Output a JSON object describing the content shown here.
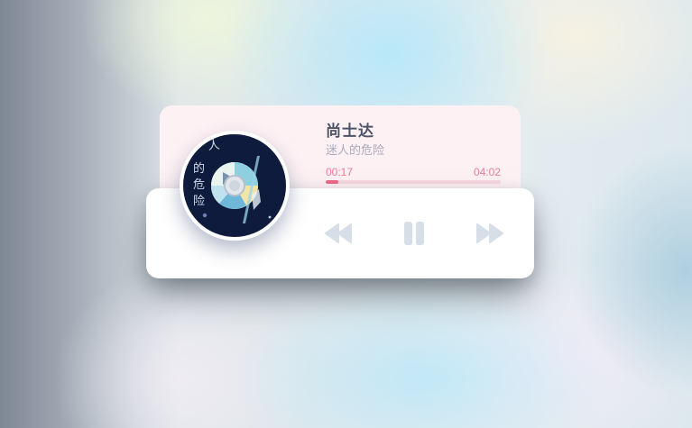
{
  "track": {
    "title": "尚士达",
    "artist": "迷人的危险",
    "current_time": "00:17",
    "total_time": "04:02",
    "progress": 0.07
  },
  "cover": {
    "lettering": "迷人的危险"
  },
  "controls": {
    "prev_icon": "rewind-icon",
    "play_icon": "pause-icon",
    "next_icon": "fast-forward-icon"
  },
  "colors": {
    "accent": "#ee6a87",
    "info_card_bg": "#fdf1f4",
    "control_icon": "#d6dfe8",
    "title_text": "#4e5468",
    "artist_text": "#a9abbc"
  }
}
